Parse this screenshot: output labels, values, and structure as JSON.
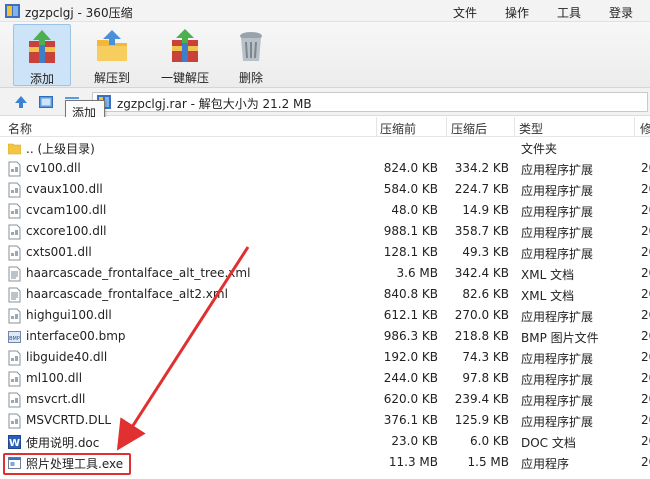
{
  "window": {
    "title": "zgzpclgj - 360压缩",
    "menu": [
      "文件",
      "操作",
      "工具",
      "登录"
    ]
  },
  "toolbar": {
    "buttons": [
      {
        "label": "添加",
        "icon": "add-archive-icon"
      },
      {
        "label": "解压到",
        "icon": "extract-to-icon"
      },
      {
        "label": "一键解压",
        "icon": "one-click-extract-icon"
      },
      {
        "label": "删除",
        "icon": "trash-can-icon"
      }
    ]
  },
  "tooltip": "添加",
  "address": {
    "text": "zgzpclgj.rar - 解包大小为 21.2 MB"
  },
  "columns": [
    "名称",
    "压缩前",
    "压缩后",
    "类型",
    "修"
  ],
  "files": [
    {
      "name": ".. (上级目录)",
      "size": "",
      "packed": "",
      "type": "文件夹",
      "modified": "",
      "icon": "folder-icon"
    },
    {
      "name": "cv100.dll",
      "size": "824.0 KB",
      "packed": "334.2 KB",
      "type": "应用程序扩展",
      "modified": "20",
      "icon": "dll-file-icon"
    },
    {
      "name": "cvaux100.dll",
      "size": "584.0 KB",
      "packed": "224.7 KB",
      "type": "应用程序扩展",
      "modified": "20",
      "icon": "dll-file-icon"
    },
    {
      "name": "cvcam100.dll",
      "size": "48.0 KB",
      "packed": "14.9 KB",
      "type": "应用程序扩展",
      "modified": "20",
      "icon": "dll-file-icon"
    },
    {
      "name": "cxcore100.dll",
      "size": "988.1 KB",
      "packed": "358.7 KB",
      "type": "应用程序扩展",
      "modified": "20",
      "icon": "dll-file-icon"
    },
    {
      "name": "cxts001.dll",
      "size": "128.1 KB",
      "packed": "49.3 KB",
      "type": "应用程序扩展",
      "modified": "20",
      "icon": "dll-file-icon"
    },
    {
      "name": "haarcascade_frontalface_alt_tree.xml",
      "size": "3.6 MB",
      "packed": "342.4 KB",
      "type": "XML 文档",
      "modified": "20",
      "icon": "xml-file-icon"
    },
    {
      "name": "haarcascade_frontalface_alt2.xml",
      "size": "840.8 KB",
      "packed": "82.6 KB",
      "type": "XML 文档",
      "modified": "20",
      "icon": "xml-file-icon"
    },
    {
      "name": "highgui100.dll",
      "size": "612.1 KB",
      "packed": "270.0 KB",
      "type": "应用程序扩展",
      "modified": "20",
      "icon": "dll-file-icon"
    },
    {
      "name": "interface00.bmp",
      "size": "986.3 KB",
      "packed": "218.8 KB",
      "type": "BMP 图片文件",
      "modified": "20",
      "icon": "bmp-file-icon"
    },
    {
      "name": "libguide40.dll",
      "size": "192.0 KB",
      "packed": "74.3 KB",
      "type": "应用程序扩展",
      "modified": "20",
      "icon": "dll-file-icon"
    },
    {
      "name": "ml100.dll",
      "size": "244.0 KB",
      "packed": "97.8 KB",
      "type": "应用程序扩展",
      "modified": "20",
      "icon": "dll-file-icon"
    },
    {
      "name": "msvcrt.dll",
      "size": "620.0 KB",
      "packed": "239.4 KB",
      "type": "应用程序扩展",
      "modified": "20",
      "icon": "dll-file-icon"
    },
    {
      "name": "MSVCRTD.DLL",
      "size": "376.1 KB",
      "packed": "125.9 KB",
      "type": "应用程序扩展",
      "modified": "20",
      "icon": "dll-file-icon"
    },
    {
      "name": "使用说明.doc",
      "size": "23.0 KB",
      "packed": "6.0 KB",
      "type": "DOC 文档",
      "modified": "20",
      "icon": "word-doc-icon"
    },
    {
      "name": "照片处理工具.exe",
      "size": "11.3 MB",
      "packed": "1.5 MB",
      "type": "应用程序",
      "modified": "20",
      "icon": "exe-file-icon"
    }
  ],
  "colors": {
    "highlight": "#e03030",
    "selected_tool": "#cde3f7"
  }
}
